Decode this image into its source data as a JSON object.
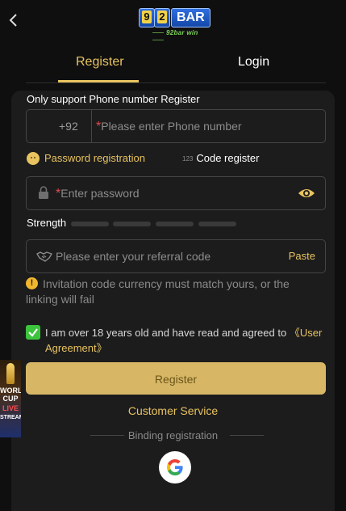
{
  "header": {
    "back_icon": "chevron-left-icon",
    "logo": {
      "digit1": "9",
      "digit2": "2",
      "word": "BAR",
      "sub": "92bar",
      "sub2": "win"
    }
  },
  "tabs": [
    {
      "label": "Register",
      "active": true
    },
    {
      "label": "Login",
      "active": false
    }
  ],
  "form": {
    "phone_section_label": "Only support Phone number Register",
    "phone": {
      "country_code": "+92",
      "required_mark": "*",
      "placeholder": "Please enter Phone number"
    },
    "reg_options": {
      "password": "Password registration",
      "code_prefix": "123",
      "code": "Code register"
    },
    "password": {
      "required_mark": "*",
      "placeholder": "Enter password",
      "icon": "lock-icon",
      "toggle_icon": "eye-icon"
    },
    "strength": {
      "label": "Strength",
      "level": 0,
      "bars": 4
    },
    "referral": {
      "placeholder": "Please enter your referral code",
      "paste_label": "Paste",
      "icon": "handshake-icon"
    },
    "note": "Invitation code currency must match yours, or the linking will fail",
    "note_icon": "warning-icon",
    "agreement": {
      "checked": true,
      "text": "I am over 18 years old and have read and agreed to",
      "link": "《User Agreement》"
    },
    "register_button": "Register",
    "customer_service": "Customer Service",
    "binding_label": "Binding registration",
    "social_icon": "google-icon"
  },
  "side_banner": {
    "lines": [
      "WORLD",
      "CUP",
      "LIVE",
      "STREAM"
    ]
  },
  "colors": {
    "accent": "#e8c35f",
    "button": "#d7b766",
    "check": "#3cc43c",
    "background": "#0f0f10",
    "card": "#1c1c1d"
  }
}
